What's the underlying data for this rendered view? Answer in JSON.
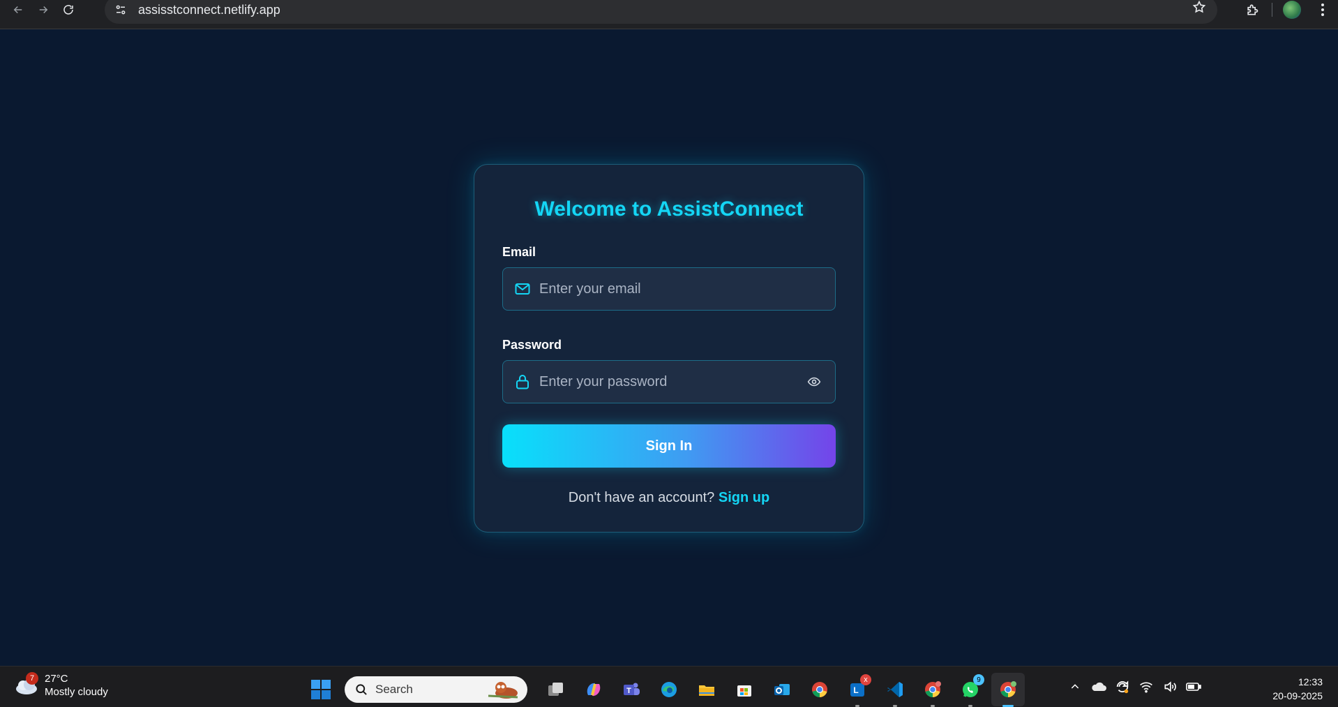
{
  "browser": {
    "url": "assisstconnect.netlify.app"
  },
  "login": {
    "title": "Welcome to AssistConnect",
    "email_label": "Email",
    "email_placeholder": "Enter your email",
    "password_label": "Password",
    "password_placeholder": "Enter your password",
    "submit_label": "Sign In",
    "signup_prompt": "Don't have an account?",
    "signup_link": "Sign up"
  },
  "taskbar": {
    "weather": {
      "badge": "7",
      "temperature": "27°C",
      "condition": "Mostly cloudy"
    },
    "search_label": "Search",
    "apps": [
      {
        "name": "task-view",
        "badge": ""
      },
      {
        "name": "copilot",
        "badge": ""
      },
      {
        "name": "teams",
        "badge": ""
      },
      {
        "name": "edge",
        "badge": ""
      },
      {
        "name": "file-explorer",
        "badge": ""
      },
      {
        "name": "microsoft-store",
        "badge": ""
      },
      {
        "name": "outlook",
        "badge": ""
      },
      {
        "name": "chrome",
        "badge": ""
      },
      {
        "name": "lync",
        "badge": "x"
      },
      {
        "name": "vscode",
        "badge": ""
      },
      {
        "name": "chrome-profile",
        "badge": ""
      },
      {
        "name": "whatsapp",
        "badge": "9"
      },
      {
        "name": "chrome-active",
        "badge": ""
      }
    ],
    "clock": {
      "time": "12:33",
      "date": "20-09-2025"
    }
  },
  "colors": {
    "page_bg": "#0a1930",
    "card_bg": "#14243b",
    "accent": "#14d6f5",
    "button_gradient_start": "#08e0fb",
    "button_gradient_end": "#7444e9"
  }
}
